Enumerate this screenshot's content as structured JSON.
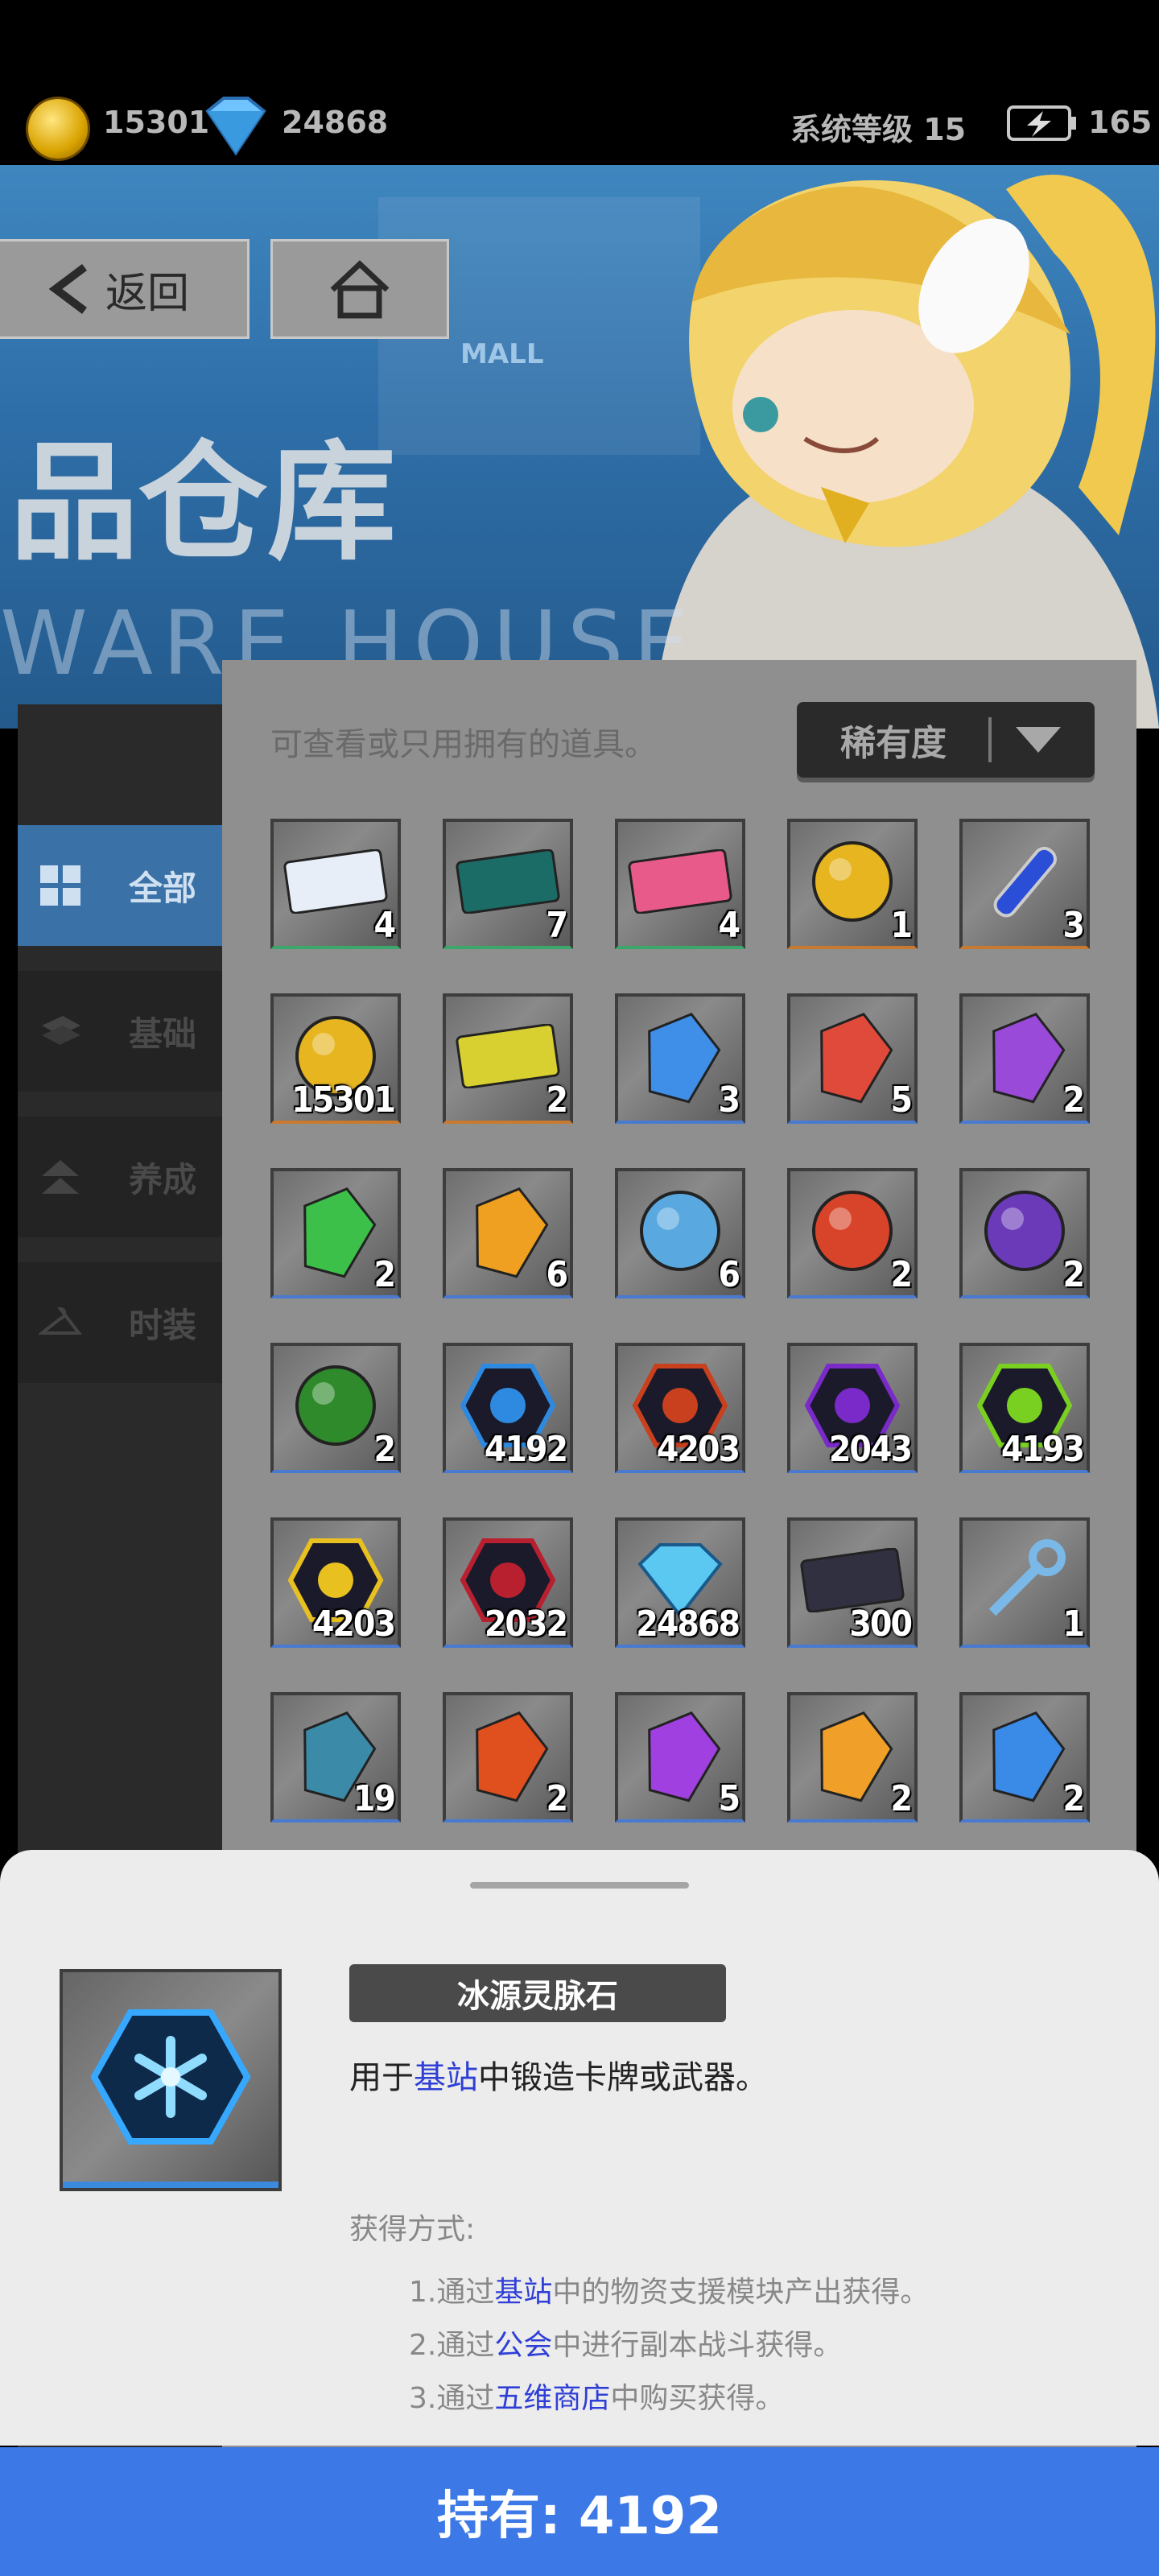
{
  "top_bar": {
    "coins": "15301",
    "gems": "24868",
    "system_level": "系统等级 15",
    "energy": "165"
  },
  "header": {
    "back_label": "返回",
    "title": "品仓库",
    "subtitle": "WARE HOUSE",
    "mall_sign": "MALL"
  },
  "panel": {
    "hint": "可查看或只用拥有的道具。",
    "sort_label": "稀有度"
  },
  "sidebar": {
    "items": [
      {
        "label": "全部",
        "icon": "grid-icon",
        "active": true
      },
      {
        "label": "基础",
        "icon": "layers-icon",
        "active": false
      },
      {
        "label": "养成",
        "icon": "double-arrow-up-icon",
        "active": false
      },
      {
        "label": "时装",
        "icon": "hanger-icon",
        "active": false
      }
    ]
  },
  "items": [
    {
      "name": "mission-ticket",
      "count": "4",
      "rarity": "green"
    },
    {
      "name": "b1-card",
      "count": "7",
      "rarity": "green"
    },
    {
      "name": "pink-ticket",
      "count": "4",
      "rarity": "green"
    },
    {
      "name": "gold-coin",
      "count": "1",
      "rarity": "orange"
    },
    {
      "name": "potion-vial",
      "count": "3",
      "rarity": "orange"
    },
    {
      "name": "gold-coin",
      "count": "15301",
      "rarity": "orange"
    },
    {
      "name": "yellow-ticket",
      "count": "2",
      "rarity": "orange"
    },
    {
      "name": "blue-crystal",
      "count": "3",
      "rarity": "blue"
    },
    {
      "name": "red-crystal",
      "count": "5",
      "rarity": "blue"
    },
    {
      "name": "purple-crystal",
      "count": "2",
      "rarity": "blue"
    },
    {
      "name": "green-crystal",
      "count": "2",
      "rarity": "blue"
    },
    {
      "name": "orange-crystal",
      "count": "6",
      "rarity": "blue"
    },
    {
      "name": "blue-orb",
      "count": "6",
      "rarity": "blue"
    },
    {
      "name": "red-orb",
      "count": "2",
      "rarity": "blue"
    },
    {
      "name": "purple-orb",
      "count": "2",
      "rarity": "blue"
    },
    {
      "name": "green-orb",
      "count": "2",
      "rarity": "blue"
    },
    {
      "name": "ice-vein-stone",
      "count": "4192",
      "rarity": "blue"
    },
    {
      "name": "fire-vein-stone",
      "count": "4203",
      "rarity": "blue"
    },
    {
      "name": "purple-vein-stone",
      "count": "2043",
      "rarity": "blue"
    },
    {
      "name": "green-vein-stone",
      "count": "4193",
      "rarity": "blue"
    },
    {
      "name": "gold-vein-stone",
      "count": "4203",
      "rarity": "blue"
    },
    {
      "name": "red-vein-stone",
      "count": "2032",
      "rarity": "blue"
    },
    {
      "name": "diamond",
      "count": "24868",
      "rarity": "blue"
    },
    {
      "name": "dark-card",
      "count": "300",
      "rarity": "blue"
    },
    {
      "name": "key",
      "count": "1",
      "rarity": "blue"
    },
    {
      "name": "teal-gem",
      "count": "19",
      "rarity": "blue"
    },
    {
      "name": "red-gem",
      "count": "2",
      "rarity": "blue"
    },
    {
      "name": "purple-gem",
      "count": "5",
      "rarity": "blue"
    },
    {
      "name": "orange-gem",
      "count": "2",
      "rarity": "blue"
    },
    {
      "name": "blue-gem",
      "count": "2",
      "rarity": "blue"
    }
  ],
  "detail": {
    "name": "冰源灵脉石",
    "desc_prefix": "用于",
    "desc_link": "基站",
    "desc_suffix": "中锻造卡牌或武器。",
    "obtain_title": "获得方式:",
    "methods": [
      {
        "prefix": "1.通过",
        "link": "基站",
        "suffix": "中的物资支援模块产出获得。"
      },
      {
        "prefix": "2.通过",
        "link": "公会",
        "suffix": "中进行副本战斗获得。"
      },
      {
        "prefix": "3.通过",
        "link": "五维商店",
        "suffix": "中购买获得。"
      }
    ]
  },
  "footer": {
    "owned_label": "持有: 4192"
  },
  "colors": {
    "footer_blue": "#3c78e6",
    "link_blue": "#2f3fd6",
    "active_tab": "#3a72a8"
  }
}
